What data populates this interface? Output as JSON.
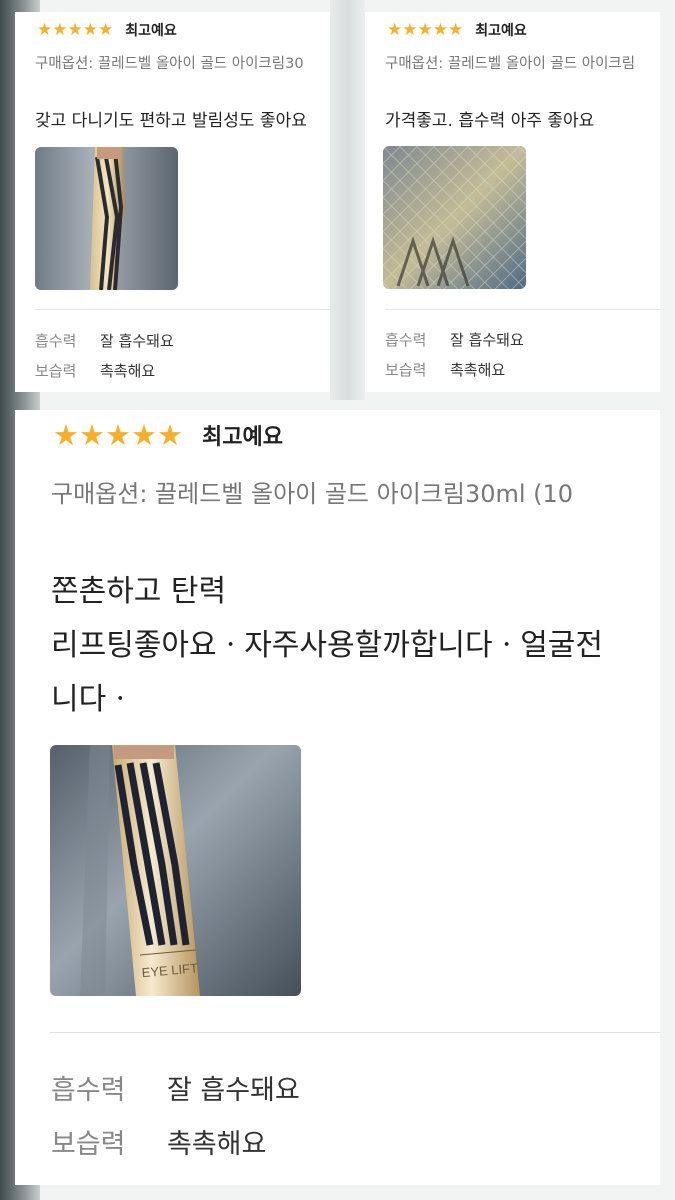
{
  "reviews": [
    {
      "stars": "★★★★★",
      "rating_label": "최고예요",
      "option": "구매옵션: 끌레드벨 올아이 골드 아이크림30",
      "text_lines": [
        "갖고 다니기도 편하고 발림성도 좋아요"
      ],
      "photo_icon": "product-photo-tube",
      "attributes": [
        {
          "key": "흡수력",
          "value": "잘 흡수돼요"
        },
        {
          "key": "보습력",
          "value": "촉촉해요"
        }
      ]
    },
    {
      "stars": "★★★★★",
      "rating_label": "최고예요",
      "option": "구매옵션: 끌레드벨 올아이 골드 아이크림",
      "text_lines": [
        "가격좋고. 흡수력 아주 좋아요"
      ],
      "photo_icon": "product-photo-box",
      "attributes": [
        {
          "key": "흡수력",
          "value": "잘 흡수돼요"
        },
        {
          "key": "보습력",
          "value": "촉촉해요"
        }
      ]
    },
    {
      "stars": "★★★★★",
      "rating_label": "최고예요",
      "option": "구매옵션: 끌레드벨 올아이 골드 아이크림30ml (10",
      "text_lines": [
        "쫀촌하고 탄력",
        "리프팅좋아요ㆍ자주사용할까합니다ㆍ얼굴전",
        "니다ㆍ"
      ],
      "photo_icon": "product-photo-tube",
      "photo_text": "EYE LIFT",
      "attributes": [
        {
          "key": "흡수력",
          "value": "잘 흡수돼요"
        },
        {
          "key": "보습력",
          "value": "촉촉해요"
        }
      ]
    }
  ],
  "colors": {
    "star": "#f5b12e",
    "option_text": "#777777",
    "attr_key": "#888888"
  }
}
